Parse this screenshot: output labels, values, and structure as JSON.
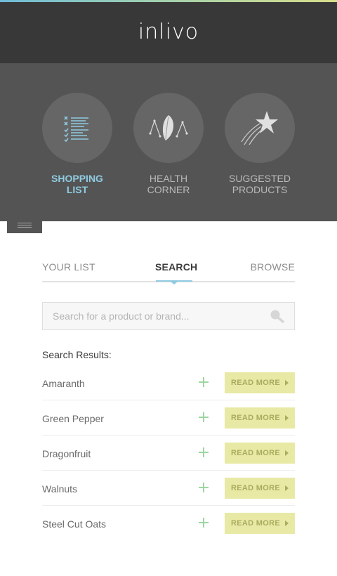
{
  "app": {
    "logo": "inlivo"
  },
  "categories": [
    {
      "label_line1": "SHOPPING",
      "label_line2": "LIST",
      "icon": "checklist-icon",
      "active": true
    },
    {
      "label_line1": "HEALTH",
      "label_line2": "CORNER",
      "icon": "seed-icon",
      "active": false
    },
    {
      "label_line1": "SUGGESTED",
      "label_line2": "PRODUCTS",
      "icon": "shooting-star-icon",
      "active": false
    }
  ],
  "menu": {
    "icon": "hamburger-icon"
  },
  "tabs": [
    {
      "label": "YOUR LIST",
      "active": false
    },
    {
      "label": "SEARCH",
      "active": true
    },
    {
      "label": "BROWSE",
      "active": false
    }
  ],
  "search": {
    "placeholder": "Search for a product or brand...",
    "value": "",
    "icon": "search-icon"
  },
  "results": {
    "title": "Search Results:",
    "items": [
      {
        "name": "Amaranth",
        "action": "READ MORE"
      },
      {
        "name": "Green Pepper",
        "action": "READ MORE"
      },
      {
        "name": "Dragonfruit",
        "action": "READ MORE"
      },
      {
        "name": "Walnuts",
        "action": "READ MORE"
      },
      {
        "name": "Steel Cut Oats",
        "action": "READ MORE"
      }
    ]
  },
  "colors": {
    "header": "#383838",
    "hero": "#545454",
    "accent_blue": "#8fcbe0",
    "add_green": "#9cd6a0",
    "read_more_bg": "#e8e9a4",
    "read_more_text": "#a9ab5f"
  }
}
